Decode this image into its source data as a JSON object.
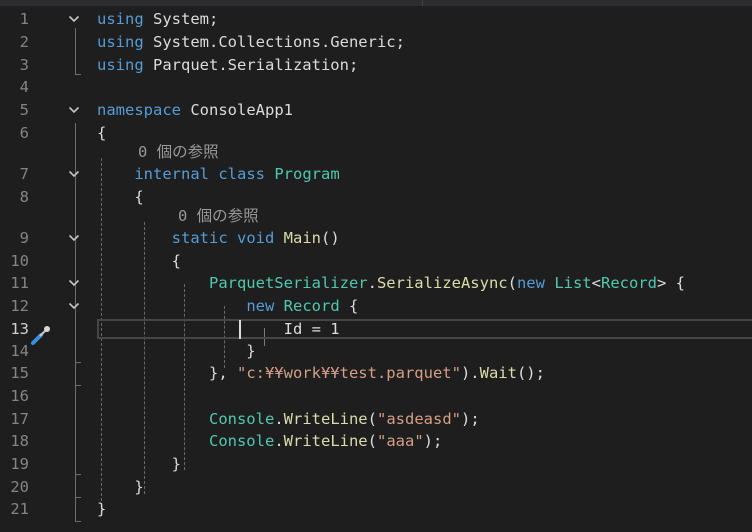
{
  "editor": {
    "active_line": 13,
    "reference_hint": "0 個の参照",
    "lines": [
      {
        "n": "1",
        "tokens": [
          [
            "kw",
            "using"
          ],
          [
            "id",
            " System;"
          ]
        ]
      },
      {
        "n": "2",
        "tokens": [
          [
            "kw",
            "using"
          ],
          [
            "id",
            " System.Collections.Generic;"
          ]
        ]
      },
      {
        "n": "3",
        "tokens": [
          [
            "kw",
            "using"
          ],
          [
            "id",
            " Parquet.Serialization;"
          ]
        ]
      },
      {
        "n": "4",
        "tokens": []
      },
      {
        "n": "5",
        "tokens": [
          [
            "kw",
            "namespace"
          ],
          [
            "id",
            " ConsoleApp1"
          ]
        ]
      },
      {
        "n": "6",
        "tokens": [
          [
            "id",
            "{"
          ]
        ]
      },
      {
        "n": "7",
        "tokens": [
          [
            "id",
            "    "
          ],
          [
            "kw",
            "internal"
          ],
          [
            "id",
            " "
          ],
          [
            "kw",
            "class"
          ],
          [
            "id",
            " "
          ],
          [
            "ty",
            "Program"
          ]
        ]
      },
      {
        "n": "8",
        "tokens": [
          [
            "id",
            "    {"
          ]
        ]
      },
      {
        "n": "9",
        "tokens": [
          [
            "id",
            "        "
          ],
          [
            "kw",
            "static"
          ],
          [
            "id",
            " "
          ],
          [
            "kw",
            "void"
          ],
          [
            "id",
            " "
          ],
          [
            "fn",
            "Main"
          ],
          [
            "id",
            "()"
          ]
        ]
      },
      {
        "n": "10",
        "tokens": [
          [
            "id",
            "        {"
          ]
        ]
      },
      {
        "n": "11",
        "tokens": [
          [
            "id",
            "            "
          ],
          [
            "ty",
            "ParquetSerializer"
          ],
          [
            "id",
            "."
          ],
          [
            "fn",
            "SerializeAsync"
          ],
          [
            "id",
            "("
          ],
          [
            "kw",
            "new"
          ],
          [
            "id",
            " "
          ],
          [
            "ty",
            "List"
          ],
          [
            "id",
            "<"
          ],
          [
            "ty",
            "Record"
          ],
          [
            "id",
            "> {"
          ]
        ]
      },
      {
        "n": "12",
        "tokens": [
          [
            "id",
            "                "
          ],
          [
            "kw",
            "new"
          ],
          [
            "id",
            " "
          ],
          [
            "ty",
            "Record"
          ],
          [
            "id",
            " {"
          ]
        ]
      },
      {
        "n": "13",
        "tokens": [
          [
            "id",
            "                    Id = 1"
          ]
        ]
      },
      {
        "n": "14",
        "tokens": [
          [
            "id",
            "                }"
          ]
        ]
      },
      {
        "n": "15",
        "tokens": [
          [
            "id",
            "            }, "
          ],
          [
            "st",
            "\"c:¥¥work¥¥test.parquet\""
          ],
          [
            "id",
            ")."
          ],
          [
            "fn",
            "Wait"
          ],
          [
            "id",
            "();"
          ]
        ]
      },
      {
        "n": "16",
        "tokens": []
      },
      {
        "n": "17",
        "tokens": [
          [
            "id",
            "            "
          ],
          [
            "ty",
            "Console"
          ],
          [
            "id",
            "."
          ],
          [
            "fn",
            "WriteLine"
          ],
          [
            "id",
            "("
          ],
          [
            "st",
            "\"asdeasd\""
          ],
          [
            "id",
            ");"
          ]
        ]
      },
      {
        "n": "18",
        "tokens": [
          [
            "id",
            "            "
          ],
          [
            "ty",
            "Console"
          ],
          [
            "id",
            "."
          ],
          [
            "fn",
            "WriteLine"
          ],
          [
            "id",
            "("
          ],
          [
            "st",
            "\"aaa\""
          ],
          [
            "id",
            ");"
          ]
        ]
      },
      {
        "n": "19",
        "tokens": [
          [
            "id",
            "        }"
          ]
        ]
      },
      {
        "n": "20",
        "tokens": [
          [
            "id",
            "    }"
          ]
        ]
      },
      {
        "n": "21",
        "tokens": [
          [
            "id",
            "}"
          ]
        ]
      }
    ],
    "folds": [
      "1",
      "5",
      "7",
      "9",
      "11",
      "12"
    ],
    "icons": {
      "fold": "chevron-down-icon",
      "quick_action": "screwdriver-brush-icon"
    }
  }
}
